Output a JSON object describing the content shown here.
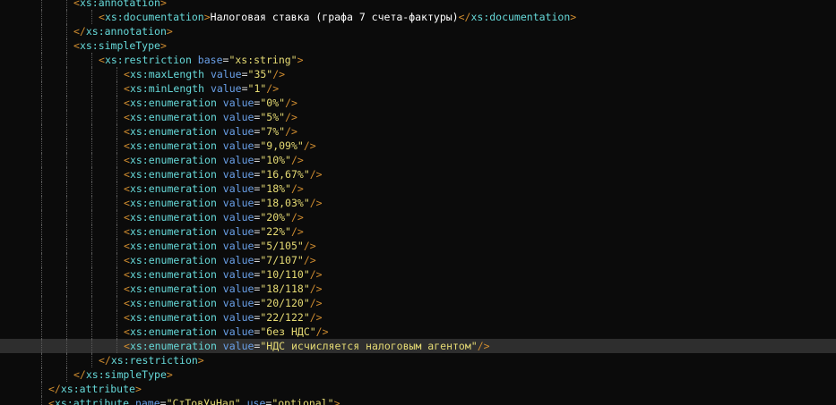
{
  "editor": {
    "language": "XML Schema (XSD)",
    "current_line_index": 24,
    "colors": {
      "background": "#0b0b0b",
      "current_line": "#2e2e2e",
      "bracket": "#cf8c2f",
      "tag": "#66d9d9",
      "attr_name": "#6aa0e8",
      "attr_value": "#e6db74",
      "text": "#ffffff",
      "indent_guide": "#5b5b5b"
    },
    "lines": [
      {
        "indent": 2,
        "parts": [
          {
            "t": "<",
            "k": "br"
          },
          {
            "t": "xs:annotation",
            "k": "tg"
          },
          {
            "t": ">",
            "k": "br"
          }
        ]
      },
      {
        "indent": 3,
        "parts": [
          {
            "t": "<",
            "k": "br"
          },
          {
            "t": "xs:documentation",
            "k": "tg"
          },
          {
            "t": ">",
            "k": "br"
          },
          {
            "t": "Налоговая ставка (графа 7 счета-фактуры)",
            "k": "tx"
          },
          {
            "t": "</",
            "k": "br"
          },
          {
            "t": "xs:documentation",
            "k": "tg"
          },
          {
            "t": ">",
            "k": "br"
          }
        ]
      },
      {
        "indent": 2,
        "parts": [
          {
            "t": "</",
            "k": "br"
          },
          {
            "t": "xs:annotation",
            "k": "tg"
          },
          {
            "t": ">",
            "k": "br"
          }
        ]
      },
      {
        "indent": 2,
        "parts": [
          {
            "t": "<",
            "k": "br"
          },
          {
            "t": "xs:simpleType",
            "k": "tg"
          },
          {
            "t": ">",
            "k": "br"
          }
        ]
      },
      {
        "indent": 3,
        "parts": [
          {
            "t": "<",
            "k": "br"
          },
          {
            "t": "xs:restriction",
            "k": "tg"
          },
          {
            "t": " base",
            "k": "an"
          },
          {
            "t": "=",
            "k": "eq"
          },
          {
            "t": "\"xs:string\"",
            "k": "av"
          },
          {
            "t": ">",
            "k": "br"
          }
        ]
      },
      {
        "indent": 4,
        "parts": [
          {
            "t": "<",
            "k": "br"
          },
          {
            "t": "xs:maxLength",
            "k": "tg"
          },
          {
            "t": " value",
            "k": "an"
          },
          {
            "t": "=",
            "k": "eq"
          },
          {
            "t": "\"35\"",
            "k": "av"
          },
          {
            "t": "/>",
            "k": "br"
          }
        ]
      },
      {
        "indent": 4,
        "parts": [
          {
            "t": "<",
            "k": "br"
          },
          {
            "t": "xs:minLength",
            "k": "tg"
          },
          {
            "t": " value",
            "k": "an"
          },
          {
            "t": "=",
            "k": "eq"
          },
          {
            "t": "\"1\"",
            "k": "av"
          },
          {
            "t": "/>",
            "k": "br"
          }
        ]
      },
      {
        "indent": 4,
        "parts": [
          {
            "t": "<",
            "k": "br"
          },
          {
            "t": "xs:enumeration",
            "k": "tg"
          },
          {
            "t": " value",
            "k": "an"
          },
          {
            "t": "=",
            "k": "eq"
          },
          {
            "t": "\"0%\"",
            "k": "av"
          },
          {
            "t": "/>",
            "k": "br"
          }
        ]
      },
      {
        "indent": 4,
        "parts": [
          {
            "t": "<",
            "k": "br"
          },
          {
            "t": "xs:enumeration",
            "k": "tg"
          },
          {
            "t": " value",
            "k": "an"
          },
          {
            "t": "=",
            "k": "eq"
          },
          {
            "t": "\"5%\"",
            "k": "av"
          },
          {
            "t": "/>",
            "k": "br"
          }
        ]
      },
      {
        "indent": 4,
        "parts": [
          {
            "t": "<",
            "k": "br"
          },
          {
            "t": "xs:enumeration",
            "k": "tg"
          },
          {
            "t": " value",
            "k": "an"
          },
          {
            "t": "=",
            "k": "eq"
          },
          {
            "t": "\"7%\"",
            "k": "av"
          },
          {
            "t": "/>",
            "k": "br"
          }
        ]
      },
      {
        "indent": 4,
        "parts": [
          {
            "t": "<",
            "k": "br"
          },
          {
            "t": "xs:enumeration",
            "k": "tg"
          },
          {
            "t": " value",
            "k": "an"
          },
          {
            "t": "=",
            "k": "eq"
          },
          {
            "t": "\"9,09%\"",
            "k": "av"
          },
          {
            "t": "/>",
            "k": "br"
          }
        ]
      },
      {
        "indent": 4,
        "parts": [
          {
            "t": "<",
            "k": "br"
          },
          {
            "t": "xs:enumeration",
            "k": "tg"
          },
          {
            "t": " value",
            "k": "an"
          },
          {
            "t": "=",
            "k": "eq"
          },
          {
            "t": "\"10%\"",
            "k": "av"
          },
          {
            "t": "/>",
            "k": "br"
          }
        ]
      },
      {
        "indent": 4,
        "parts": [
          {
            "t": "<",
            "k": "br"
          },
          {
            "t": "xs:enumeration",
            "k": "tg"
          },
          {
            "t": " value",
            "k": "an"
          },
          {
            "t": "=",
            "k": "eq"
          },
          {
            "t": "\"16,67%\"",
            "k": "av"
          },
          {
            "t": "/>",
            "k": "br"
          }
        ]
      },
      {
        "indent": 4,
        "parts": [
          {
            "t": "<",
            "k": "br"
          },
          {
            "t": "xs:enumeration",
            "k": "tg"
          },
          {
            "t": " value",
            "k": "an"
          },
          {
            "t": "=",
            "k": "eq"
          },
          {
            "t": "\"18%\"",
            "k": "av"
          },
          {
            "t": "/>",
            "k": "br"
          }
        ]
      },
      {
        "indent": 4,
        "parts": [
          {
            "t": "<",
            "k": "br"
          },
          {
            "t": "xs:enumeration",
            "k": "tg"
          },
          {
            "t": " value",
            "k": "an"
          },
          {
            "t": "=",
            "k": "eq"
          },
          {
            "t": "\"18,03%\"",
            "k": "av"
          },
          {
            "t": "/>",
            "k": "br"
          }
        ]
      },
      {
        "indent": 4,
        "parts": [
          {
            "t": "<",
            "k": "br"
          },
          {
            "t": "xs:enumeration",
            "k": "tg"
          },
          {
            "t": " value",
            "k": "an"
          },
          {
            "t": "=",
            "k": "eq"
          },
          {
            "t": "\"20%\"",
            "k": "av"
          },
          {
            "t": "/>",
            "k": "br"
          }
        ]
      },
      {
        "indent": 4,
        "parts": [
          {
            "t": "<",
            "k": "br"
          },
          {
            "t": "xs:enumeration",
            "k": "tg"
          },
          {
            "t": " value",
            "k": "an"
          },
          {
            "t": "=",
            "k": "eq"
          },
          {
            "t": "\"22%\"",
            "k": "av"
          },
          {
            "t": "/>",
            "k": "br"
          }
        ]
      },
      {
        "indent": 4,
        "parts": [
          {
            "t": "<",
            "k": "br"
          },
          {
            "t": "xs:enumeration",
            "k": "tg"
          },
          {
            "t": " value",
            "k": "an"
          },
          {
            "t": "=",
            "k": "eq"
          },
          {
            "t": "\"5/105\"",
            "k": "av"
          },
          {
            "t": "/>",
            "k": "br"
          }
        ]
      },
      {
        "indent": 4,
        "parts": [
          {
            "t": "<",
            "k": "br"
          },
          {
            "t": "xs:enumeration",
            "k": "tg"
          },
          {
            "t": " value",
            "k": "an"
          },
          {
            "t": "=",
            "k": "eq"
          },
          {
            "t": "\"7/107\"",
            "k": "av"
          },
          {
            "t": "/>",
            "k": "br"
          }
        ]
      },
      {
        "indent": 4,
        "parts": [
          {
            "t": "<",
            "k": "br"
          },
          {
            "t": "xs:enumeration",
            "k": "tg"
          },
          {
            "t": " value",
            "k": "an"
          },
          {
            "t": "=",
            "k": "eq"
          },
          {
            "t": "\"10/110\"",
            "k": "av"
          },
          {
            "t": "/>",
            "k": "br"
          }
        ]
      },
      {
        "indent": 4,
        "parts": [
          {
            "t": "<",
            "k": "br"
          },
          {
            "t": "xs:enumeration",
            "k": "tg"
          },
          {
            "t": " value",
            "k": "an"
          },
          {
            "t": "=",
            "k": "eq"
          },
          {
            "t": "\"18/118\"",
            "k": "av"
          },
          {
            "t": "/>",
            "k": "br"
          }
        ]
      },
      {
        "indent": 4,
        "parts": [
          {
            "t": "<",
            "k": "br"
          },
          {
            "t": "xs:enumeration",
            "k": "tg"
          },
          {
            "t": " value",
            "k": "an"
          },
          {
            "t": "=",
            "k": "eq"
          },
          {
            "t": "\"20/120\"",
            "k": "av"
          },
          {
            "t": "/>",
            "k": "br"
          }
        ]
      },
      {
        "indent": 4,
        "parts": [
          {
            "t": "<",
            "k": "br"
          },
          {
            "t": "xs:enumeration",
            "k": "tg"
          },
          {
            "t": " value",
            "k": "an"
          },
          {
            "t": "=",
            "k": "eq"
          },
          {
            "t": "\"22/122\"",
            "k": "av"
          },
          {
            "t": "/>",
            "k": "br"
          }
        ]
      },
      {
        "indent": 4,
        "parts": [
          {
            "t": "<",
            "k": "br"
          },
          {
            "t": "xs:enumeration",
            "k": "tg"
          },
          {
            "t": " value",
            "k": "an"
          },
          {
            "t": "=",
            "k": "eq"
          },
          {
            "t": "\"без НДС\"",
            "k": "av"
          },
          {
            "t": "/>",
            "k": "br"
          }
        ]
      },
      {
        "indent": 4,
        "parts": [
          {
            "t": "<",
            "k": "br"
          },
          {
            "t": "xs:enumeration",
            "k": "tg"
          },
          {
            "t": " value",
            "k": "an"
          },
          {
            "t": "=",
            "k": "eq"
          },
          {
            "t": "\"НДС исчисляется налоговым агентом\"",
            "k": "av"
          },
          {
            "t": "/>",
            "k": "br"
          }
        ]
      },
      {
        "indent": 3,
        "parts": [
          {
            "t": "</",
            "k": "br"
          },
          {
            "t": "xs:restriction",
            "k": "tg"
          },
          {
            "t": ">",
            "k": "br"
          }
        ]
      },
      {
        "indent": 2,
        "parts": [
          {
            "t": "</",
            "k": "br"
          },
          {
            "t": "xs:simpleType",
            "k": "tg"
          },
          {
            "t": ">",
            "k": "br"
          }
        ]
      },
      {
        "indent": 1,
        "parts": [
          {
            "t": "</",
            "k": "br"
          },
          {
            "t": "xs:attribute",
            "k": "tg"
          },
          {
            "t": ">",
            "k": "br"
          }
        ]
      },
      {
        "indent": 1,
        "parts": [
          {
            "t": "<",
            "k": "br"
          },
          {
            "t": "xs:attribute",
            "k": "tg"
          },
          {
            "t": " name",
            "k": "an"
          },
          {
            "t": "=",
            "k": "eq"
          },
          {
            "t": "\"СтТовУчНал\"",
            "k": "av"
          },
          {
            "t": " use",
            "k": "an"
          },
          {
            "t": "=",
            "k": "eq"
          },
          {
            "t": "\"optional\"",
            "k": "av"
          },
          {
            "t": ">",
            "k": "br"
          }
        ]
      }
    ]
  }
}
